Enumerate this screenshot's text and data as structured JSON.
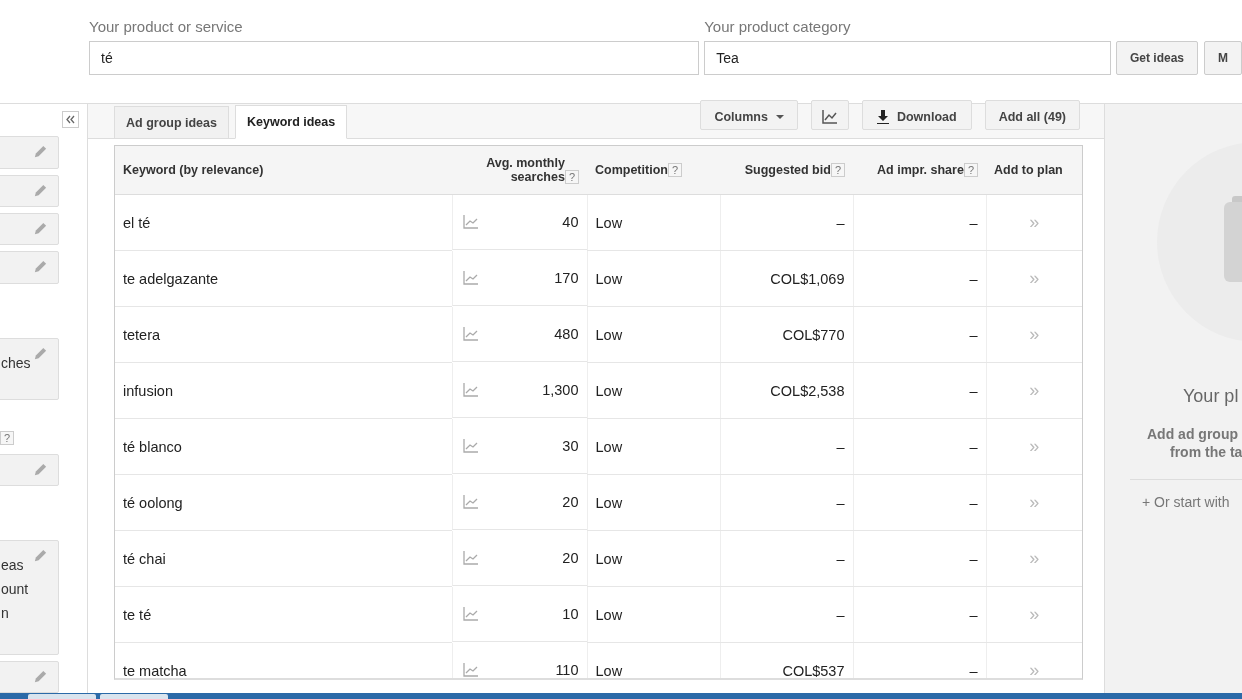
{
  "search_form": {
    "product": {
      "label": "Your product or service",
      "value": "té"
    },
    "category": {
      "label": "Your product category",
      "value": "Tea"
    },
    "buttons": [
      "Get ideas",
      "M"
    ]
  },
  "sidebar": {
    "items": [
      {
        "kind": "card"
      },
      {
        "kind": "card"
      },
      {
        "kind": "card"
      },
      {
        "kind": "card"
      },
      {
        "kind": "card",
        "lines": [
          "ches"
        ]
      },
      {
        "kind": "help",
        "label": "?"
      },
      {
        "kind": "card"
      },
      {
        "kind": "card",
        "lines": [
          "eas",
          "ount",
          "n"
        ]
      },
      {
        "kind": "card"
      }
    ]
  },
  "tabs": [
    {
      "label": "Ad group ideas",
      "selected": false
    },
    {
      "label": "Keyword ideas",
      "selected": true
    }
  ],
  "toolbar": {
    "columns": "Columns",
    "download": "Download",
    "add_all": "Add all (49)"
  },
  "table": {
    "columns": [
      {
        "label": "Keyword (by relevance)"
      },
      {
        "label": "Avg. monthly searches",
        "help": "?"
      },
      {
        "label": "Competition",
        "help": "?"
      },
      {
        "label": "Suggested bid",
        "help": "?"
      },
      {
        "label": "Ad impr. share",
        "help": "?"
      },
      {
        "label": "Add to plan"
      }
    ],
    "rows": [
      {
        "keyword": "el té",
        "searches": "40",
        "competition": "Low",
        "bid": "–",
        "share": "–",
        "add": "»"
      },
      {
        "keyword": "te adelgazante",
        "searches": "170",
        "competition": "Low",
        "bid": "COL$1,069",
        "share": "–",
        "add": "»"
      },
      {
        "keyword": "tetera",
        "searches": "480",
        "competition": "Low",
        "bid": "COL$770",
        "share": "–",
        "add": "»"
      },
      {
        "keyword": "infusion",
        "searches": "1,300",
        "competition": "Low",
        "bid": "COL$2,538",
        "share": "–",
        "add": "»"
      },
      {
        "keyword": "té blanco",
        "searches": "30",
        "competition": "Low",
        "bid": "–",
        "share": "–",
        "add": "»"
      },
      {
        "keyword": "té oolong",
        "searches": "20",
        "competition": "Low",
        "bid": "–",
        "share": "–",
        "add": "»"
      },
      {
        "keyword": "té chai",
        "searches": "20",
        "competition": "Low",
        "bid": "–",
        "share": "–",
        "add": "»"
      },
      {
        "keyword": "te té",
        "searches": "10",
        "competition": "Low",
        "bid": "–",
        "share": "–",
        "add": "»"
      },
      {
        "keyword": "te matcha",
        "searches": "110",
        "competition": "Low",
        "bid": "COL$537",
        "share": "–",
        "add": "»"
      }
    ]
  },
  "plan_panel": {
    "title": "Your pl",
    "description": [
      "Add ad group",
      "from the ta"
    ],
    "link": "+ Or start with"
  }
}
